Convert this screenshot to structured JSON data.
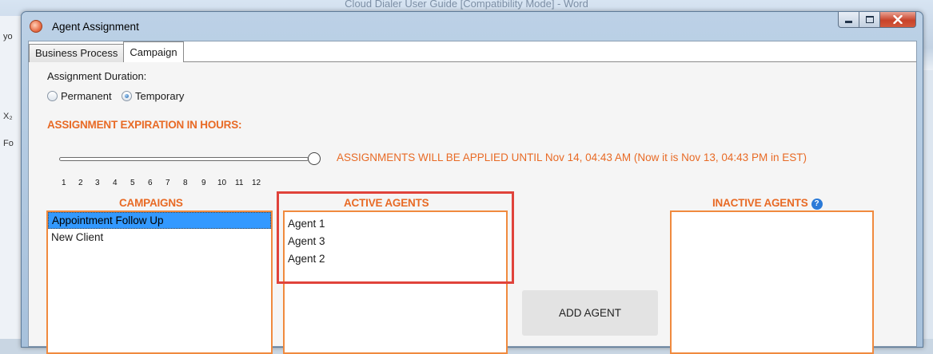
{
  "background": {
    "word_title": "Cloud Dialer User Guide [Compatibility Mode] - Word",
    "left_fragments": [
      "yo",
      "X₂",
      "Fo"
    ]
  },
  "window": {
    "title": "Agent Assignment",
    "controls": {
      "minimize": "minimize-icon",
      "maximize": "maximize-icon",
      "close": "close-icon"
    }
  },
  "tabs": [
    {
      "label": "Business Process",
      "active": false
    },
    {
      "label": "Campaign",
      "active": true
    }
  ],
  "assignment": {
    "duration_label": "Assignment Duration:",
    "options": [
      {
        "label": "Permanent",
        "selected": false
      },
      {
        "label": "Temporary",
        "selected": true
      }
    ],
    "expiration_heading": "ASSIGNMENT EXPIRATION IN HOURS:",
    "slider_value": 12,
    "slider_ticks": [
      "1",
      "2",
      "3",
      "4",
      "5",
      "6",
      "7",
      "8",
      "9",
      "10",
      "11",
      "12"
    ],
    "apply_note": "ASSIGNMENTS WILL BE APPLIED UNTIL Nov 14, 04:43 AM (Now it is Nov 13, 04:43 PM in EST)"
  },
  "campaigns": {
    "heading": "CAMPAIGNS",
    "items": [
      "Appointment Follow Up",
      "New Client"
    ],
    "selected_index": 0
  },
  "active_agents": {
    "heading": "ACTIVE AGENTS",
    "items": [
      "Agent 1",
      "Agent 3",
      "Agent 2"
    ]
  },
  "add_agent_label": "ADD AGENT",
  "inactive_agents": {
    "heading": "INACTIVE AGENTS",
    "help_icon": "?",
    "items": []
  },
  "colors": {
    "accent_orange": "#e86a25",
    "highlight_red": "#e0433b",
    "selection_blue": "#3399ff"
  }
}
